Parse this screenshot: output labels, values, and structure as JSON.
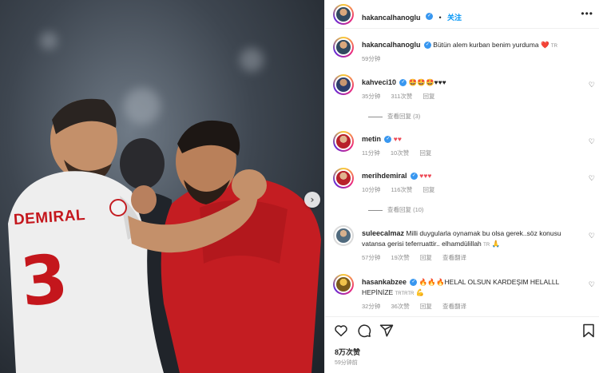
{
  "photo": {
    "jersey_name": "DEMIRAL",
    "jersey_number": "3",
    "next_glyph": "›"
  },
  "header": {
    "username": "hakancalhanoglu",
    "follow_label": "关注",
    "more_label": "•••"
  },
  "caption": {
    "username": "hakancalhanoglu",
    "text": "Bütün alem kurban benim yurduma",
    "emoji": "❤️",
    "tr": "TR",
    "time": "59分钟"
  },
  "comments": [
    {
      "username": "kahveci10",
      "text": "🤩🤩🤩♥♥♥",
      "time": "35分钟",
      "likes": "311次赞",
      "reply": "回复",
      "view_replies": "查看回复 (3)"
    },
    {
      "username": "metin",
      "text": "♥♥",
      "time": "11分钟",
      "likes": "10次赞",
      "reply": "回复"
    },
    {
      "username": "merihdemiral",
      "text": "♥♥♥",
      "time": "10分钟",
      "likes": "116次赞",
      "reply": "回复",
      "view_replies": "查看回复 (10)"
    },
    {
      "username": "suleecalmaz",
      "text": "Milli duygularla oynamak bu olsa gerek..söz konusu vatansa gerisi teferruattir.. elhamdülillah",
      "tr": "TR",
      "emoji": "🙏",
      "time": "57分钟",
      "likes": "19次赞",
      "reply": "回复",
      "translate": "查看翻译"
    },
    {
      "username": "hasankabzee",
      "text": "🔥🔥🔥HELAL OLSUN KARDEŞIM HELALLL HEPİNİZE",
      "tr": "TRTRTR",
      "emoji": "💪",
      "time": "32分钟",
      "likes": "36次赞",
      "reply": "回复",
      "translate": "查看翻译"
    }
  ],
  "footer": {
    "likes": "8万次赞",
    "posted": "59分钟前"
  },
  "icons": [
    "heart-icon",
    "comment-icon",
    "share-icon",
    "bookmark-icon",
    "verified-icon",
    "more-icon",
    "next-arrow-icon"
  ],
  "colors": {
    "accent": "#0095f6",
    "verified": "#3897f0",
    "heart": "#ed4956",
    "muted": "#8e8e8e"
  }
}
